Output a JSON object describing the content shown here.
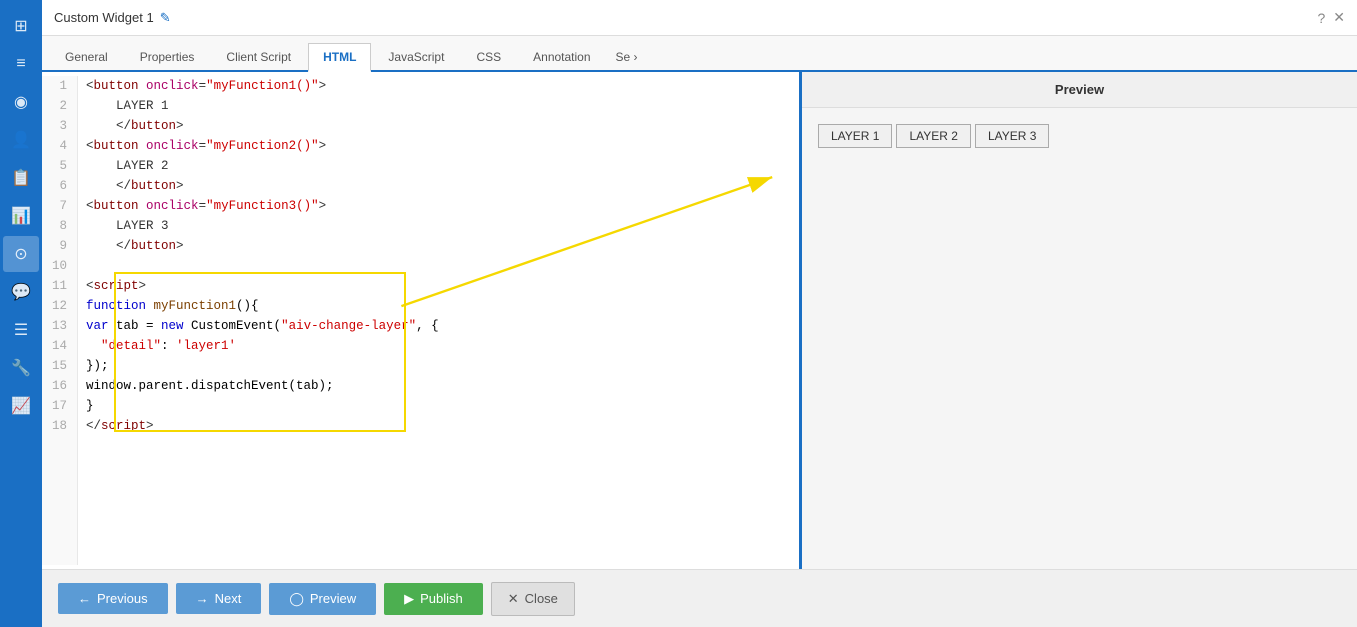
{
  "titleBar": {
    "title": "Custom Widget 1",
    "editIcon": "✎",
    "helpIcon": "?",
    "closeIcon": "✕"
  },
  "tabs": [
    {
      "label": "General",
      "active": false
    },
    {
      "label": "Properties",
      "active": false
    },
    {
      "label": "Client Script",
      "active": false
    },
    {
      "label": "HTML",
      "active": true
    },
    {
      "label": "JavaScript",
      "active": false
    },
    {
      "label": "CSS",
      "active": false
    },
    {
      "label": "Annotation",
      "active": false
    },
    {
      "label": "Se",
      "active": false,
      "more": true
    }
  ],
  "codeLines": [
    {
      "num": "1",
      "html": "<span class='plain'>&lt;<span class='tag'>button</span> <span class='attr'>onclick</span>=<span class='str'>\"myFunction1()\"</span>&gt;</span>"
    },
    {
      "num": "2",
      "html": "<span class='plain'>    LAYER 1</span>"
    },
    {
      "num": "3",
      "html": "<span class='plain'>    &lt;/<span class='tag'>button</span>&gt;</span>"
    },
    {
      "num": "4",
      "html": "<span class='plain'>&lt;<span class='tag'>button</span> <span class='attr'>onclick</span>=<span class='str'>\"myFunction2()\"</span>&gt;</span>"
    },
    {
      "num": "5",
      "html": "<span class='plain'>    LAYER 2</span>"
    },
    {
      "num": "6",
      "html": "<span class='plain'>    &lt;/<span class='tag'>button</span>&gt;</span>"
    },
    {
      "num": "7",
      "html": "<span class='plain'>&lt;<span class='tag'>button</span> <span class='attr'>onclick</span>=<span class='str'>\"myFunction3()\"</span>&gt;</span>"
    },
    {
      "num": "8",
      "html": "<span class='plain'>    LAYER 3</span>"
    },
    {
      "num": "9",
      "html": "<span class='plain'>    &lt;/<span class='tag'>button</span>&gt;</span>"
    },
    {
      "num": "10",
      "html": ""
    },
    {
      "num": "11",
      "html": "<span class='plain'>&lt;<span class='tag'>script</span>&gt;</span>"
    },
    {
      "num": "12",
      "html": "<span class='kw'>function</span> <span class='fn'>myFunction1</span>(){"
    },
    {
      "num": "13",
      "html": "<span class='kw'>var</span> tab = <span class='kw'>new</span> CustomEvent(<span class='str'>\"aiv-change-layer\"</span>, {"
    },
    {
      "num": "14",
      "html": "  <span class='str'>\"detail\"</span>: <span class='str'>'layer1'</span>"
    },
    {
      "num": "15",
      "html": "});"
    },
    {
      "num": "16",
      "html": "window.parent.dispatchEvent(tab);"
    },
    {
      "num": "17",
      "html": "}"
    },
    {
      "num": "18",
      "html": "<span class='plain'>&lt;/<span class='tag'>script</span>&gt;</span>"
    }
  ],
  "preview": {
    "title": "Preview",
    "buttons": [
      "LAYER 1",
      "LAYER 2",
      "LAYER 3"
    ]
  },
  "bottomBar": {
    "prevLabel": "Previous",
    "nextLabel": "Next",
    "previewLabel": "Preview",
    "publishLabel": "Publish",
    "closeLabel": "Close"
  },
  "sidebarIcons": [
    "⊞",
    "≡",
    "◉",
    "👤",
    "📋",
    "📊",
    "⊙",
    "💬",
    "☰",
    "🔧",
    "📈"
  ],
  "colors": {
    "accent": "#1a6fc4",
    "sidebarBg": "#1a6fc4",
    "publishGreen": "#4caf50",
    "highlightYellow": "#f5d800"
  }
}
